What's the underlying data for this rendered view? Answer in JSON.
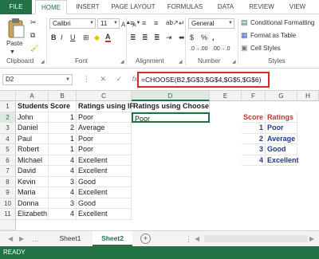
{
  "ribbon_tabs": [
    "FILE",
    "HOME",
    "INSERT",
    "PAGE LAYOUT",
    "FORMULAS",
    "DATA",
    "REVIEW",
    "VIEW"
  ],
  "clipboard": {
    "paste_label": "Paste",
    "group_label": "Clipboard"
  },
  "font": {
    "name": "Calibri",
    "size": "11",
    "group_label": "Font",
    "bold": "B",
    "italic": "I",
    "underline": "U",
    "font_color_glyph": "A"
  },
  "alignment": {
    "group_label": "Alignment"
  },
  "number": {
    "format": "General",
    "group_label": "Number",
    "currency": "$",
    "percent": "%",
    "comma": ","
  },
  "styles": {
    "conditional_formatting": "Conditional Formatting",
    "format_as_table": "Format as Table",
    "cell_styles": "Cell Styles",
    "group_label": "Styles"
  },
  "formula_bar": {
    "name_box": "D2",
    "fx": "fx",
    "formula": "=CHOOSE(B2,$G$3,$G$4,$G$5,$G$6)"
  },
  "columns": [
    "A",
    "B",
    "C",
    "D",
    "E",
    "F",
    "G",
    "H"
  ],
  "rows": [
    "1",
    "2",
    "3",
    "4",
    "5",
    "6",
    "7",
    "8",
    "9",
    "10",
    "11"
  ],
  "headers": {
    "students": "Students",
    "score": "Score",
    "ratings_if": "Ratings using IF",
    "ratings_choose": "Ratings using Choose"
  },
  "data_rows": [
    {
      "student": "John",
      "score": "1",
      "rating_if": "Poor",
      "rating_choose": "Poor"
    },
    {
      "student": "Daniel",
      "score": "2",
      "rating_if": "Average",
      "rating_choose": ""
    },
    {
      "student": "Paul",
      "score": "1",
      "rating_if": "Poor",
      "rating_choose": ""
    },
    {
      "student": "Robert",
      "score": "1",
      "rating_if": "Poor",
      "rating_choose": ""
    },
    {
      "student": "Michael",
      "score": "4",
      "rating_if": "Excellent",
      "rating_choose": ""
    },
    {
      "student": "David",
      "score": "4",
      "rating_if": "Excellent",
      "rating_choose": ""
    },
    {
      "student": "Kevin",
      "score": "3",
      "rating_if": "Good",
      "rating_choose": ""
    },
    {
      "student": "Maria",
      "score": "4",
      "rating_if": "Excellent",
      "rating_choose": ""
    },
    {
      "student": "Donna",
      "score": "3",
      "rating_if": "Good",
      "rating_choose": ""
    },
    {
      "student": "Elizabeth",
      "score": "4",
      "rating_if": "Excellent",
      "rating_choose": ""
    }
  ],
  "lookup": {
    "score_header": "Score",
    "ratings_header": "Ratings",
    "rows": [
      {
        "score": "1",
        "rating": "Poor"
      },
      {
        "score": "2",
        "rating": "Average"
      },
      {
        "score": "3",
        "rating": "Good"
      },
      {
        "score": "4",
        "rating": "Excellent"
      }
    ]
  },
  "sheets": [
    "Sheet1",
    "Sheet2"
  ],
  "active_sheet": "Sheet2",
  "add_sheet": "+",
  "status": "READY",
  "colors": {
    "excel_green": "#217346",
    "highlight_red": "#d42a2a",
    "lookup_score": "#c0392b",
    "lookup_rating": "#1f3c88"
  }
}
